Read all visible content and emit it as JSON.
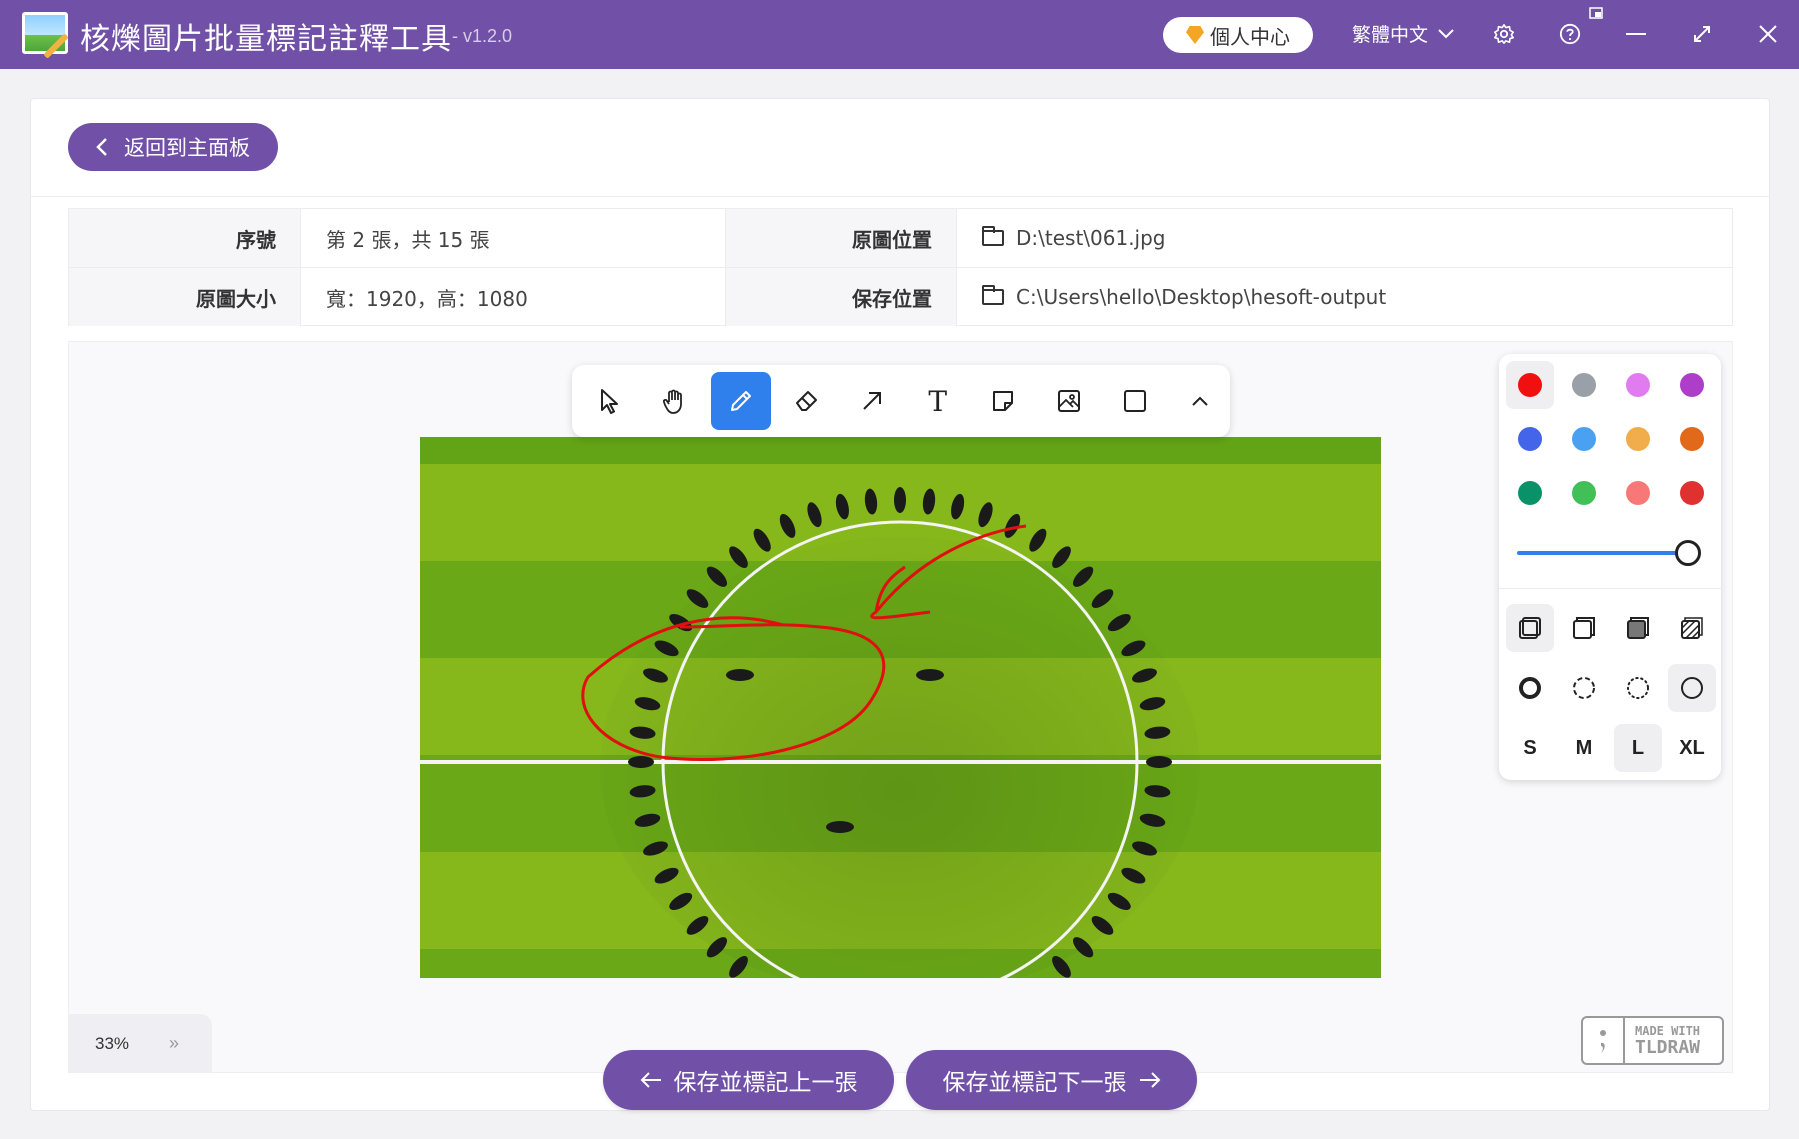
{
  "window": {
    "title": "核爍圖片批量標記註釋工具",
    "version": "- v1.2.0",
    "vip_label": "個人中心",
    "language": "繁體中文"
  },
  "back_button": {
    "label": "返回到主面板"
  },
  "info": {
    "index_label": "序號",
    "index_value": "第 2 張，共 15 張",
    "source_label": "原圖位置",
    "source_value": "D:\\test\\061.jpg",
    "size_label": "原圖大小",
    "size_value": "寬：1920，高：1080",
    "save_label": "保存位置",
    "save_value": "C:\\Users\\hello\\Desktop\\hesoft-output"
  },
  "toolbar": {
    "tools": [
      "select",
      "hand",
      "draw",
      "eraser",
      "arrow",
      "text",
      "note",
      "image",
      "rectangle",
      "more"
    ],
    "active_tool": "draw",
    "text_tool_glyph": "T"
  },
  "style_panel": {
    "colors": [
      "#f01010",
      "#9aa0a8",
      "#e17cf0",
      "#ae3ec9",
      "#4465e9",
      "#4ba1f1",
      "#f1ac4b",
      "#e16919",
      "#099268",
      "#40c057",
      "#f87777",
      "#e03131"
    ],
    "selected_color": "#f01010",
    "opacity": 1.0,
    "sizes": [
      "S",
      "M",
      "L",
      "XL"
    ],
    "selected_size": "L"
  },
  "zoom": {
    "value": "33%",
    "expand_glyph": "»"
  },
  "watermark": {
    "line1": "MADE WITH",
    "line2": "TLDRAW"
  },
  "nav": {
    "prev_label": "保存並標記上一張",
    "next_label": "保存並標記下一張"
  }
}
